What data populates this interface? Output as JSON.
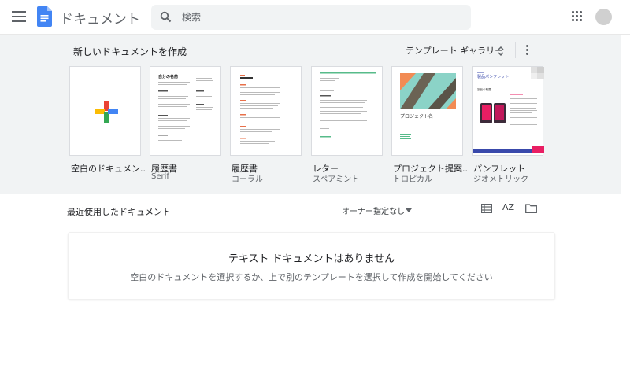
{
  "header": {
    "title": "ドキュメント",
    "search_placeholder": "検索"
  },
  "templates": {
    "heading": "新しいドキュメントを作成",
    "gallery_label": "テンプレート ギャラリー",
    "items": [
      {
        "label": "空白のドキュメン...",
        "sub": ""
      },
      {
        "label": "履歴書",
        "sub": "Serif"
      },
      {
        "label": "履歴書",
        "sub": "コーラル"
      },
      {
        "label": "レター",
        "sub": "スペアミント"
      },
      {
        "label": "プロジェクト提案...",
        "sub": "トロピカル"
      },
      {
        "label": "パンフレット",
        "sub": "ジオメトリック"
      }
    ],
    "thumb_text": {
      "resume_name": "自分の名前",
      "project_name": "プロジェクト名",
      "brochure_title": "製品パンフレット",
      "brochure_sub": "製品の概要"
    }
  },
  "recent": {
    "title": "最近使用したドキュメント",
    "owner_filter": "オーナー指定なし",
    "sort_label": "AZ",
    "empty_title": "テキスト ドキュメントはありません",
    "empty_sub": "空白のドキュメントを選択するか、上で別のテンプレートを選択して作成を開始してください"
  },
  "colors": {
    "docs_blue": "#4285f4",
    "plus_red": "#ea4335",
    "plus_yellow": "#fbbc04",
    "plus_green": "#34a853",
    "plus_blue": "#4285f4",
    "coral": "#e8704a",
    "mint": "#57bb8a",
    "brochure_magenta": "#e91e63"
  }
}
